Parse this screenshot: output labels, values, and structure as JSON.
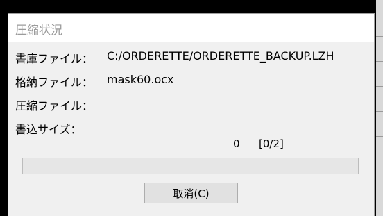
{
  "dialog": {
    "title": "圧縮状況",
    "rows": [
      {
        "label": "書庫ファイル：",
        "value": "C:/ORDERETTE/ORDERETTE_BACKUP.LZH"
      },
      {
        "label": "格納ファイル：",
        "value": "mask60.ocx"
      },
      {
        "label": "圧縮ファイル：",
        "value": ""
      },
      {
        "label": "書込サイズ：",
        "value": ""
      }
    ],
    "write_size": "0",
    "file_count": "[0/2]",
    "progress": 0,
    "cancel_label": "取消(C)"
  },
  "colors": {
    "progress_fill": "#06b025",
    "title_text": "#9b9b9b"
  }
}
